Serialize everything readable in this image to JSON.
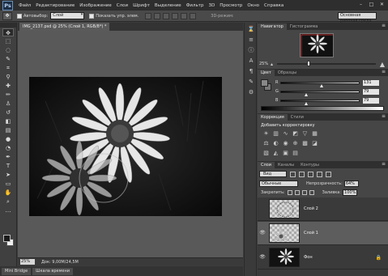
{
  "app": {
    "logo": "Ps"
  },
  "menubar": {
    "items": [
      "Файл",
      "Редактирование",
      "Изображение",
      "Слои",
      "Шрифт",
      "Выделение",
      "Фильтр",
      "3D",
      "Просмотр",
      "Окно",
      "Справка"
    ]
  },
  "window_controls": [
    "–",
    "□",
    "✕"
  ],
  "options_bar": {
    "autoselect_label": "Автовыбор:",
    "autoselect_value": "Слой",
    "transform_label": "Показать упр. элем.",
    "mode_3d_label": "3D-режим:",
    "workspace_value": "Основная рабочая среда"
  },
  "document": {
    "tab_title": "IMG_2137.psd @ 25% (Слой 1, RGB/8*) *",
    "zoom": "25%",
    "info": "Док: 9,00M/24,5M"
  },
  "bottom_tabs": [
    "Mini Bridge",
    "Шкала времени"
  ],
  "navigator": {
    "tabs": [
      "Навигатор",
      "Гистограмма"
    ],
    "zoom": "25%"
  },
  "color_panel": {
    "tabs": [
      "Цвет",
      "Образцы"
    ],
    "channels": [
      {
        "label": "R",
        "value": "131",
        "fraction": 0.51
      },
      {
        "label": "G",
        "value": "79",
        "fraction": 0.31
      },
      {
        "label": "B",
        "value": "79",
        "fraction": 0.31
      }
    ]
  },
  "adjustments": {
    "tabs": [
      "Коррекция",
      "Стили"
    ],
    "title": "Добавить корректировку"
  },
  "layers_panel": {
    "tabs": [
      "Слои",
      "Каналы",
      "Контуры"
    ],
    "kind_value": "Вид",
    "blend_mode": "Обычные",
    "opacity_label": "Непрозрачность:",
    "opacity_value": "64%",
    "lock_label": "Закрепить:",
    "fill_label": "Заливка:",
    "fill_value": "100%",
    "layers": [
      {
        "name": "Слой 2",
        "visible": false,
        "active": false
      },
      {
        "name": "Слой 1",
        "visible": true,
        "active": true
      },
      {
        "name": "Фон",
        "visible": true,
        "active": false
      }
    ]
  },
  "colors": {
    "menubar": "#2e2e2e",
    "panel": "#464646",
    "canvas_bg": "#595959",
    "active_layer": "#5d5d5d"
  }
}
